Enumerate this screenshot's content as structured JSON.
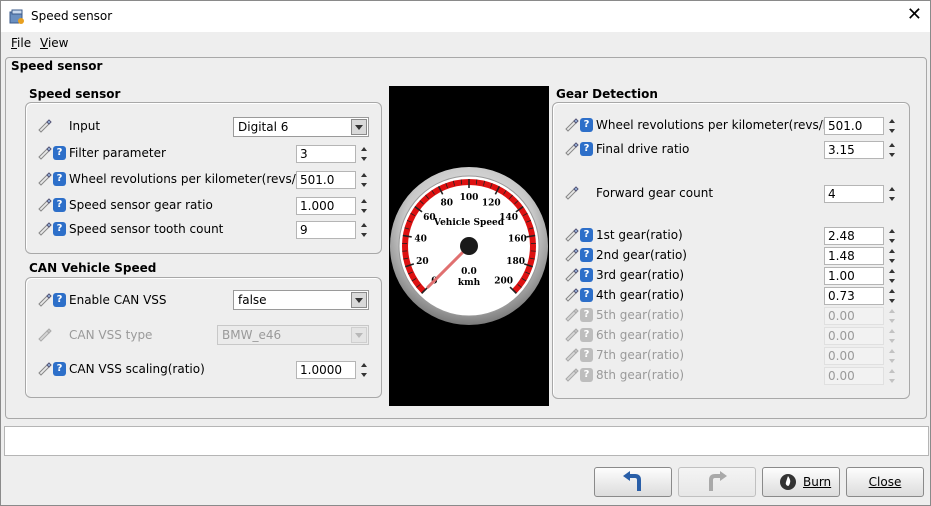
{
  "window": {
    "title": "Speed sensor"
  },
  "menu": {
    "file": "File",
    "view": "View"
  },
  "panel_title": "Speed sensor",
  "speed_sensor": {
    "title": "Speed sensor",
    "input_label": "Input",
    "input_value": "Digital 6",
    "filter_label": "Filter parameter",
    "filter_value": "3",
    "wheel_label": "Wheel revolutions per kilometer(revs/km)",
    "wheel_value": "501.0",
    "gear_ratio_label": "Speed sensor gear ratio",
    "gear_ratio_value": "1.000",
    "tooth_label": "Speed sensor tooth count",
    "tooth_value": "9"
  },
  "can_vss": {
    "title": "CAN Vehicle Speed",
    "enable_label": "Enable CAN VSS",
    "enable_value": "false",
    "type_label": "CAN VSS type",
    "type_value": "BMW_e46",
    "scaling_label": "CAN VSS scaling(ratio)",
    "scaling_value": "1.0000"
  },
  "gauge": {
    "title": "Vehicle Speed",
    "value": "0.0",
    "unit": "kmh",
    "ticks": [
      "0",
      "20",
      "40",
      "60",
      "80",
      "100",
      "120",
      "140",
      "160",
      "180",
      "200"
    ],
    "min": 0,
    "max": 200,
    "current": 0,
    "needle_color": "#e07070",
    "arc_color": "#dd1111"
  },
  "gear_detection": {
    "title": "Gear Detection",
    "wheel_label": "Wheel revolutions per kilometer(revs/km)",
    "wheel_value": "501.0",
    "final_drive_label": "Final drive ratio",
    "final_drive_value": "3.15",
    "forward_count_label": "Forward gear count",
    "forward_count_value": "4",
    "gears": [
      {
        "label": "1st gear(ratio)",
        "value": "2.48",
        "enabled": true
      },
      {
        "label": "2nd gear(ratio)",
        "value": "1.48",
        "enabled": true
      },
      {
        "label": "3rd gear(ratio)",
        "value": "1.00",
        "enabled": true
      },
      {
        "label": "4th gear(ratio)",
        "value": "0.73",
        "enabled": true
      },
      {
        "label": "5th gear(ratio)",
        "value": "0.00",
        "enabled": false
      },
      {
        "label": "6th gear(ratio)",
        "value": "0.00",
        "enabled": false
      },
      {
        "label": "7th gear(ratio)",
        "value": "0.00",
        "enabled": false
      },
      {
        "label": "8th gear(ratio)",
        "value": "0.00",
        "enabled": false
      }
    ]
  },
  "buttons": {
    "burn": "Burn",
    "close": "Close"
  }
}
